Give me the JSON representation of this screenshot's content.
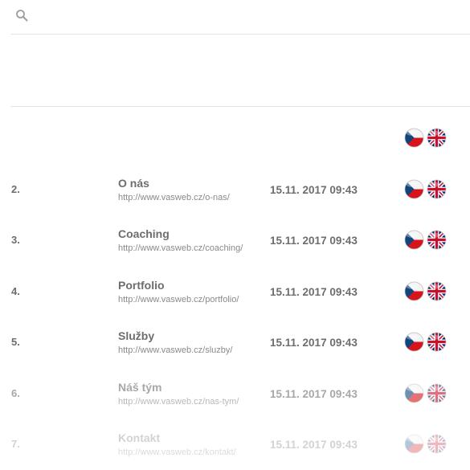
{
  "search": {
    "placeholder": "",
    "value": ""
  },
  "header_row": {
    "langs": [
      "cz",
      "en"
    ]
  },
  "rows": [
    {
      "num": "2.",
      "title": "O nás",
      "url": "http://www.vasweb.cz/o-nas/",
      "date": "15.11. 2017 09:43",
      "opacity": 1
    },
    {
      "num": "3.",
      "title": "Coaching",
      "url": "http://www.vasweb.cz/coaching/",
      "date": "15.11. 2017 09:43",
      "opacity": 1
    },
    {
      "num": "4.",
      "title": "Portfolio",
      "url": "http://www.vasweb.cz/portfolio/",
      "date": "15.11. 2017 09:43",
      "opacity": 1
    },
    {
      "num": "5.",
      "title": "Služby",
      "url": "http://www.vasweb.cz/sluzby/",
      "date": "15.11. 2017 09:43",
      "opacity": 1
    },
    {
      "num": "6.",
      "title": "Náš tým",
      "url": "http://www.vasweb.cz/nas-tym/",
      "date": "15.11. 2017 09:43",
      "opacity": 0.6
    },
    {
      "num": "7.",
      "title": "Kontakt",
      "url": "http://www.vasweb.cz/kontakt/",
      "date": "15.11. 2017 09:43",
      "opacity": 0.3
    }
  ],
  "colors": {
    "text": "#6d6d6d",
    "url": "#8a8a8a",
    "divider": "#e4e4e4"
  }
}
